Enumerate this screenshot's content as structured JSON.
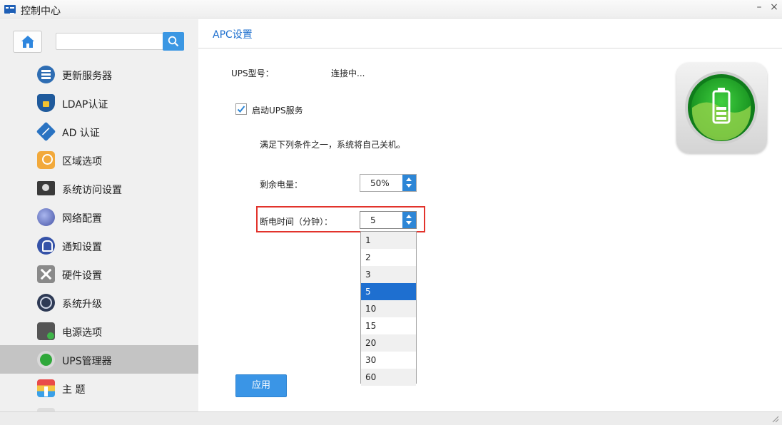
{
  "window": {
    "title": "控制中心",
    "minimize_glyph": "–",
    "close_glyph": "×"
  },
  "sidebar": {
    "search": {
      "value": "",
      "placeholder": ""
    },
    "items": [
      {
        "label": "更新服务器",
        "icon": "update-server-icon"
      },
      {
        "label": "LDAP认证",
        "icon": "ldap-shield-icon"
      },
      {
        "label": "AD 认证",
        "icon": "ad-diamond-icon"
      },
      {
        "label": "区域选项",
        "icon": "region-icon"
      },
      {
        "label": "系统访问设置",
        "icon": "access-users-icon"
      },
      {
        "label": "网络配置",
        "icon": "network-globe-icon"
      },
      {
        "label": "通知设置",
        "icon": "bell-icon"
      },
      {
        "label": "硬件设置",
        "icon": "tools-icon"
      },
      {
        "label": "系统升级",
        "icon": "upgrade-globe-icon"
      },
      {
        "label": "电源选项",
        "icon": "power-icon"
      },
      {
        "label": "UPS管理器",
        "icon": "ups-icon",
        "active": true
      },
      {
        "label": "主 题",
        "icon": "theme-icon"
      }
    ]
  },
  "main": {
    "title": "APC设置",
    "ups_model_label": "UPS型号：",
    "ups_model_value": "连接中...",
    "enable_ups_label": "启动UPS服务",
    "enable_ups_checked": true,
    "condition_text": "满足下列条件之一，系统将自己关机。",
    "battery_label": "剩余电量：",
    "battery_value": "50%",
    "outage_label": "断电时间（分钟）：",
    "outage_value": "5",
    "outage_options": [
      "1",
      "2",
      "3",
      "5",
      "10",
      "15",
      "20",
      "30",
      "60"
    ],
    "outage_selected": "5",
    "apply_label": "应用"
  },
  "colors": {
    "accent": "#1e6fd0",
    "button": "#3a95e6",
    "highlight_box": "#e2332c",
    "active_nav": "#c4c4c4"
  }
}
